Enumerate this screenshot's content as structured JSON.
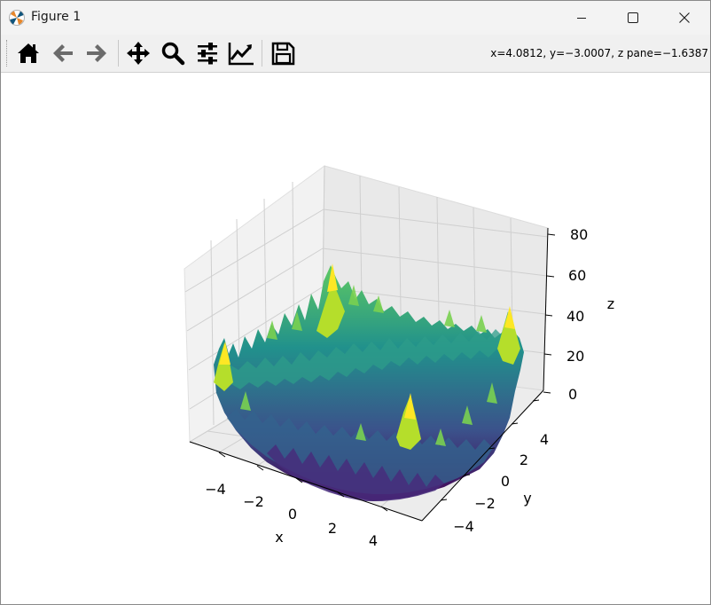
{
  "window": {
    "title": "Figure 1",
    "app_icon": "matplotlib-icon"
  },
  "controls": {
    "minimize": "minimize-icon",
    "maximize": "maximize-icon",
    "close": "close-icon"
  },
  "toolbar": {
    "buttons": [
      "home-icon",
      "back-arrow-icon",
      "forward-arrow-icon",
      "pan-icon",
      "zoom-icon",
      "configure-subplots-icon",
      "edit-axes-icon",
      "save-icon"
    ],
    "coords": "x=4.0812, y=−3.0007, z pane=−1.6387"
  },
  "chart_data": {
    "type": "surface",
    "colormap": "viridis",
    "colormap_colors": [
      "#440154",
      "#3b528b",
      "#21918c",
      "#5ec962",
      "#fde725"
    ],
    "xlabel": "x",
    "ylabel": "y",
    "zlabel": "z",
    "xlim": [
      -5,
      5
    ],
    "ylim": [
      -5,
      5
    ],
    "zlim": [
      0,
      80
    ],
    "x_ticks": [
      -4,
      -2,
      0,
      2,
      4
    ],
    "y_ticks": [
      -4,
      -2,
      0,
      2,
      4
    ],
    "z_ticks": [
      0,
      20,
      40,
      60,
      80
    ],
    "x_tick_labels": [
      "−4",
      "−2",
      "0",
      "2",
      "4"
    ],
    "y_tick_labels": [
      "−4",
      "−2",
      "0",
      "2",
      "4"
    ],
    "z_tick_labels": [
      "0",
      "20",
      "40",
      "60",
      "80"
    ],
    "grid": true
  }
}
